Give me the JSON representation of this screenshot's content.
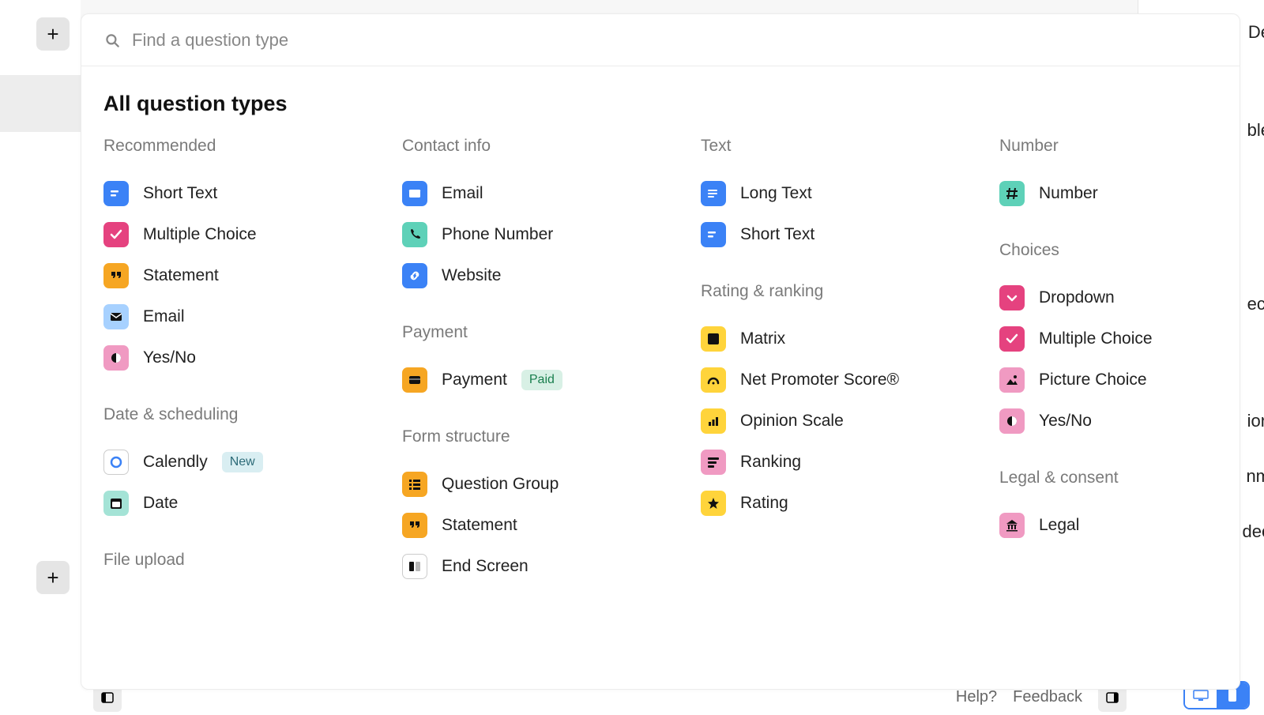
{
  "search": {
    "placeholder": "Find a question type"
  },
  "panel_title": "All question types",
  "badges": {
    "paid": "Paid",
    "new": "New"
  },
  "columns": [
    {
      "groups": [
        {
          "title": "Recommended",
          "items": [
            {
              "label": "Short Text",
              "icon": "short-text",
              "bg": "blue"
            },
            {
              "label": "Multiple Choice",
              "icon": "check",
              "bg": "pink"
            },
            {
              "label": "Statement",
              "icon": "quote",
              "bg": "orange"
            },
            {
              "label": "Email",
              "icon": "mail",
              "bg": "ltblue"
            },
            {
              "label": "Yes/No",
              "icon": "contrast",
              "bg": "ltpink"
            }
          ]
        },
        {
          "title": "Date & scheduling",
          "items": [
            {
              "label": "Calendly",
              "icon": "calendly",
              "bg": "whiteb",
              "badge": "new"
            },
            {
              "label": "Date",
              "icon": "calendar",
              "bg": "mint"
            }
          ]
        },
        {
          "title": "File upload",
          "items": []
        }
      ]
    },
    {
      "groups": [
        {
          "title": "Contact info",
          "items": [
            {
              "label": "Email",
              "icon": "mail",
              "bg": "blue"
            },
            {
              "label": "Phone Number",
              "icon": "phone",
              "bg": "teal"
            },
            {
              "label": "Website",
              "icon": "link",
              "bg": "blue"
            }
          ]
        },
        {
          "title": "Payment",
          "items": [
            {
              "label": "Payment",
              "icon": "card",
              "bg": "orange",
              "badge": "paid"
            }
          ]
        },
        {
          "title": "Form structure",
          "items": [
            {
              "label": "Question Group",
              "icon": "list",
              "bg": "orange"
            },
            {
              "label": "Statement",
              "icon": "quote",
              "bg": "orange"
            },
            {
              "label": "End Screen",
              "icon": "endscreen",
              "bg": "white"
            }
          ]
        }
      ]
    },
    {
      "groups": [
        {
          "title": "Text",
          "items": [
            {
              "label": "Long Text",
              "icon": "long-text",
              "bg": "blue"
            },
            {
              "label": "Short Text",
              "icon": "short-text",
              "bg": "blue"
            }
          ]
        },
        {
          "title": "Rating & ranking",
          "items": [
            {
              "label": "Matrix",
              "icon": "matrix",
              "bg": "yellow"
            },
            {
              "label": "Net Promoter Score®",
              "icon": "gauge",
              "bg": "yellow"
            },
            {
              "label": "Opinion Scale",
              "icon": "bars",
              "bg": "yellow"
            },
            {
              "label": "Ranking",
              "icon": "rank",
              "bg": "ltpink"
            },
            {
              "label": "Rating",
              "icon": "star",
              "bg": "yellow"
            }
          ]
        }
      ]
    },
    {
      "groups": [
        {
          "title": "Number",
          "items": [
            {
              "label": "Number",
              "icon": "hash",
              "bg": "teal"
            }
          ]
        },
        {
          "title": "Choices",
          "items": [
            {
              "label": "Dropdown",
              "icon": "chevron-down",
              "bg": "pink"
            },
            {
              "label": "Multiple Choice",
              "icon": "check",
              "bg": "pink"
            },
            {
              "label": "Picture Choice",
              "icon": "image",
              "bg": "ltpink"
            },
            {
              "label": "Yes/No",
              "icon": "contrast",
              "bg": "ltpink"
            }
          ]
        },
        {
          "title": "Legal & consent",
          "items": [
            {
              "label": "Legal",
              "icon": "bank",
              "bg": "ltpink"
            }
          ]
        }
      ]
    }
  ],
  "bottom": {
    "help": "Help?",
    "feedback": "Feedback"
  },
  "right_hints": [
    "De",
    "ble",
    "ect",
    "ion",
    "nm",
    "dec"
  ]
}
